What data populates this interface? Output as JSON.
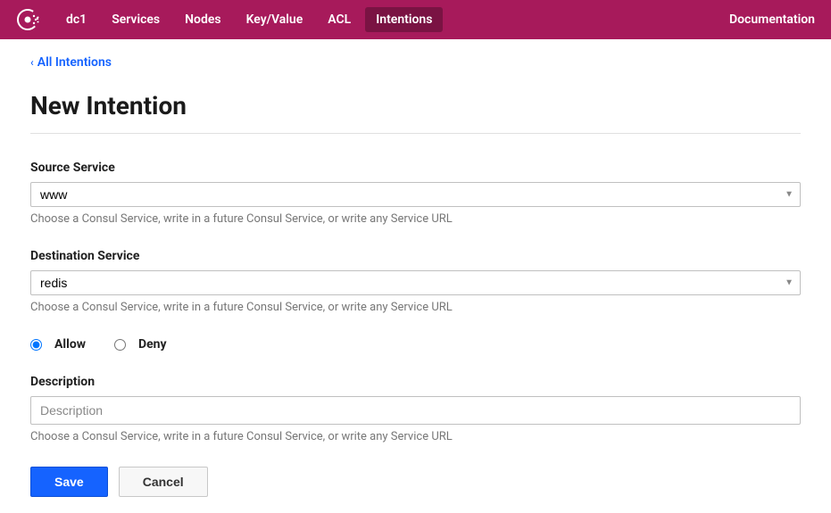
{
  "nav": {
    "datacenter": "dc1",
    "items": [
      "Services",
      "Nodes",
      "Key/Value",
      "ACL",
      "Intentions"
    ],
    "active_index": 4,
    "documentation": "Documentation"
  },
  "breadcrumb": {
    "label": "All Intentions"
  },
  "page": {
    "title": "New Intention"
  },
  "form": {
    "source": {
      "label": "Source Service",
      "value": "www",
      "help": "Choose a Consul Service, write in a future Consul Service, or write any Service URL"
    },
    "destination": {
      "label": "Destination Service",
      "value": "redis",
      "help": "Choose a Consul Service, write in a future Consul Service, or write any Service URL"
    },
    "radio": {
      "allow_label": "Allow",
      "deny_label": "Deny",
      "selected": "allow"
    },
    "description": {
      "label": "Description",
      "value": "",
      "placeholder": "Description",
      "help": "Choose a Consul Service, write in a future Consul Service, or write any Service URL"
    },
    "buttons": {
      "save": "Save",
      "cancel": "Cancel"
    }
  }
}
